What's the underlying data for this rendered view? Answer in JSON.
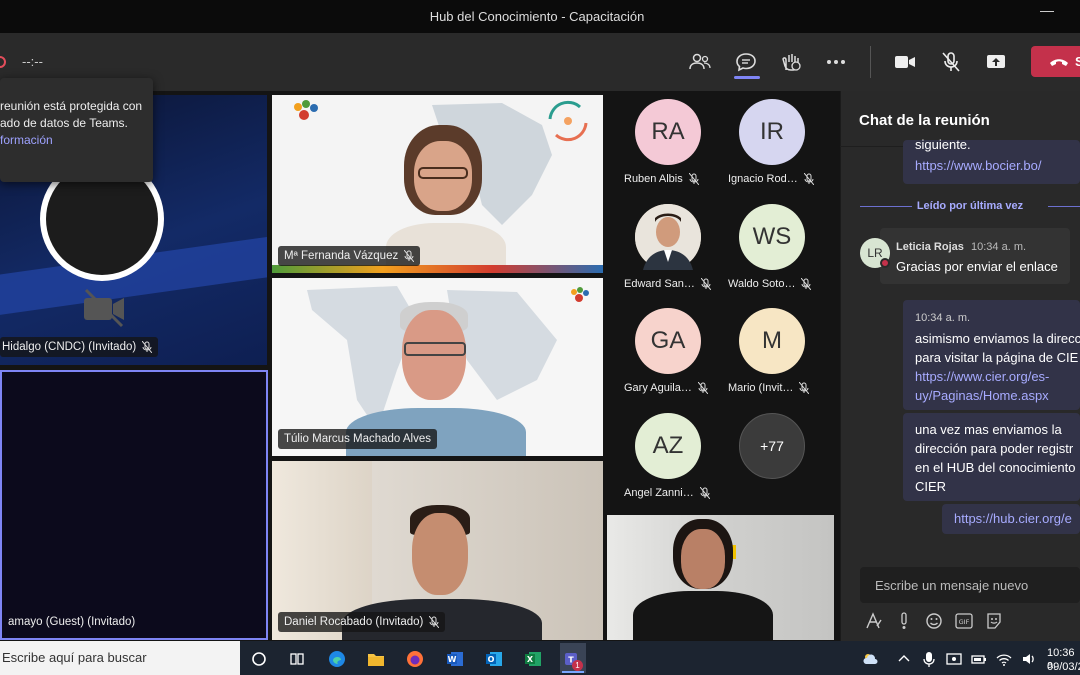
{
  "window": {
    "title": "Hub del Conocimiento - Capacitación"
  },
  "toolbar": {
    "timer": "--:--",
    "leave_label": "S"
  },
  "tooltip": {
    "line1": "reunión está protegida con",
    "line2": "ado de datos de Teams.",
    "link": "formación"
  },
  "tiles": {
    "left_top_name": "Hidalgo (CNDC) (Invitado)",
    "left_bottom_name": "amayo (Guest) (Invitado)",
    "fernanda": "Mª Fernanda Vázquez",
    "tulio": "Túlio Marcus Machado Alves",
    "daniel": "Daniel Rocabado (Invitado)"
  },
  "roster": [
    {
      "initials": "RA",
      "name": "Ruben Albis",
      "color": "#f4c9d6"
    },
    {
      "initials": "IR",
      "name": "Ignacio Rod…",
      "color": "#d6d6f0"
    },
    {
      "initials": "",
      "name": "Edward San…",
      "color": "#d8c4a8"
    },
    {
      "initials": "WS",
      "name": "Waldo Soto…",
      "color": "#e3eed5"
    },
    {
      "initials": "GA",
      "name": "Gary Aguila…",
      "color": "#f7d3cc"
    },
    {
      "initials": "M",
      "name": "Mario (Invit…",
      "color": "#f7e6c4"
    },
    {
      "initials": "AZ",
      "name": "Angel Zanni…",
      "color": "#e3eed5"
    },
    {
      "initials": "+77",
      "name": "",
      "color": "#3b3b3b"
    }
  ],
  "chat": {
    "title": "Chat de la reunión",
    "msg0_tail": "siguiente.",
    "msg0_link": "https://www.bocier.bo/",
    "last_read": "Leído por última vez",
    "leticia_initials": "LR",
    "leticia_name": "Leticia Rojas",
    "leticia_time": "10:34 a. m.",
    "leticia_msg": "Gracias por enviar el enlace",
    "me_time": "10:34 a. m.",
    "me_msg1_l1": "asimismo enviamos la direcc",
    "me_msg1_l2": "para visitar la página de CIE",
    "me_msg1_link1": "https://www.cier.org/es-",
    "me_msg1_link2": "uy/Paginas/Home.aspx",
    "me_msg2_l1": "una vez mas enviamos la",
    "me_msg2_l2": "dirección para poder registr",
    "me_msg2_l3": "en el HUB del conocimiento",
    "me_msg2_l4": "CIER",
    "me_msg3_link": "https://hub.cier.org/e",
    "compose_placeholder": "Escribe un mensaje nuevo"
  },
  "taskbar": {
    "search_placeholder": "Escribe aquí para buscar",
    "time": "10:36 a.",
    "date": "09/03/2",
    "teams_badge": "1"
  }
}
